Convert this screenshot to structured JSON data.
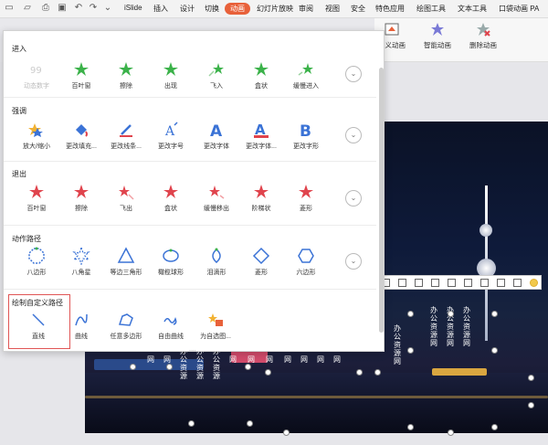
{
  "ribbon": {
    "tabs": [
      "iSlide",
      "插入",
      "设计",
      "切换",
      "动画",
      "幻灯片放映",
      "审阅",
      "视图",
      "安全",
      "特色应用",
      "绘图工具",
      "文本工具",
      "口袋动画 PA"
    ],
    "active_tab": "动画",
    "buttons": [
      "定义动画",
      "智能动画",
      "删除动画"
    ]
  },
  "panel": {
    "sections": [
      {
        "title": "进入",
        "items": [
          "动态数字",
          "百叶窗",
          "擦除",
          "出现",
          "飞入",
          "盒状",
          "缓慢进入"
        ]
      },
      {
        "title": "强调",
        "items": [
          "放大/缩小",
          "更改填充...",
          "更改线条...",
          "更改字号",
          "更改字体",
          "更改字体...",
          "更改字形"
        ]
      },
      {
        "title": "退出",
        "items": [
          "百叶窗",
          "擦除",
          "飞出",
          "盒状",
          "缓慢移出",
          "阶梯状",
          "菱形"
        ]
      },
      {
        "title": "动作路径",
        "items": [
          "八边形",
          "八角星",
          "等边三角形",
          "橄榄球形",
          "泪滴形",
          "菱形",
          "六边形"
        ]
      },
      {
        "title": "绘制自定义路径",
        "items": [
          "直线",
          "曲线",
          "任意多边形",
          "自由曲线",
          "为自选图..."
        ]
      }
    ],
    "more_label": "⌄",
    "dots": "....",
    "colors": {
      "accent": "#e8613a",
      "enter": "#3bb24a",
      "emphasis": "#3b73d6",
      "exit": "#e0444d",
      "path": "#3b73d6"
    }
  },
  "watermark": [
    "办",
    "公",
    "资",
    "源",
    "网"
  ]
}
